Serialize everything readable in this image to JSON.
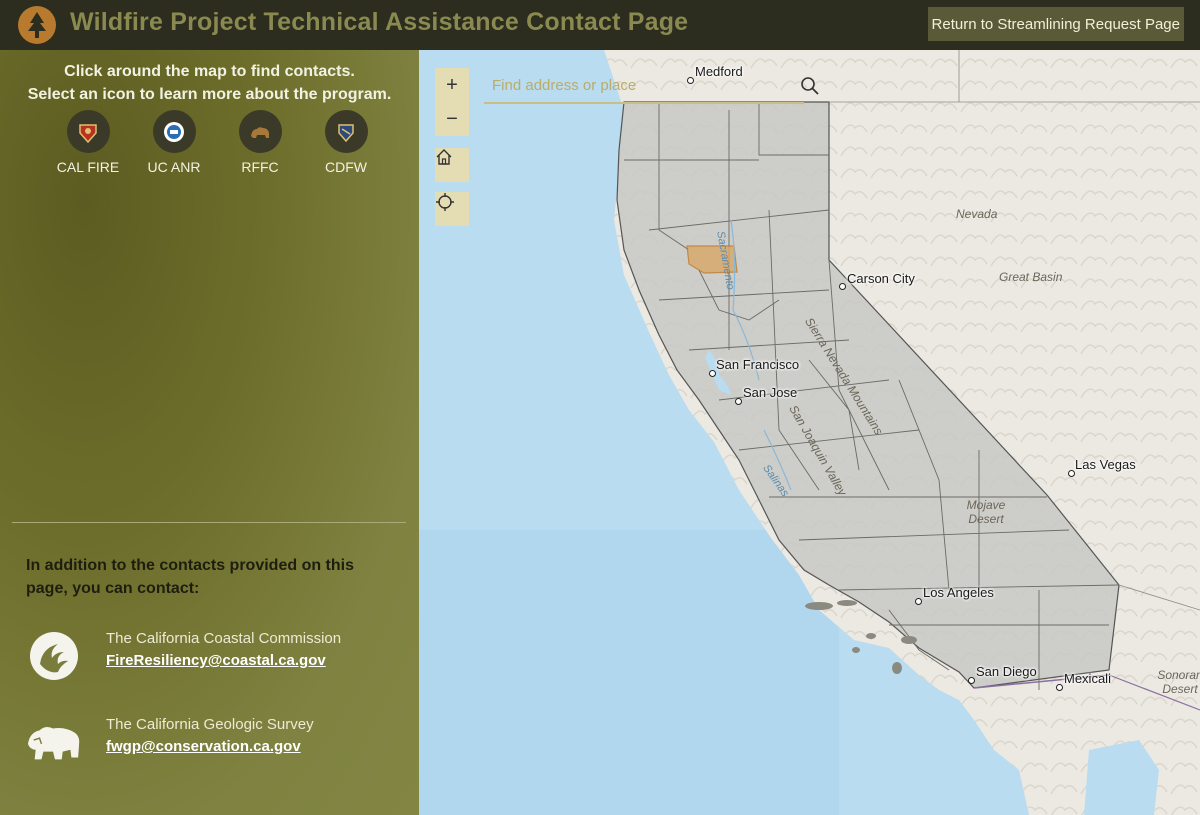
{
  "header": {
    "title": "Wildfire Project Technical Assistance Contact Page",
    "return_label": "Return to Streamlining Request Page",
    "logo_icon": "tree-logo-icon"
  },
  "sidebar": {
    "intro_line1": "Click around the map to find contacts.",
    "intro_line2": "Select an icon to learn more about the program.",
    "orgs": [
      {
        "label": "CAL FIRE",
        "icon": "cal-fire-icon"
      },
      {
        "label": "UC ANR",
        "icon": "uc-anr-icon"
      },
      {
        "label": "RFFC",
        "icon": "rffc-icon"
      },
      {
        "label": "CDFW",
        "icon": "cdfw-icon"
      }
    ],
    "also_text": "In addition to the contacts provided on this page, you can contact:",
    "contacts": [
      {
        "name": "The California Coastal Commission",
        "email": "FireResiliency@coastal.ca.gov",
        "icon": "coastal-commission-icon"
      },
      {
        "name": "The California Geologic Survey",
        "email": "fwgp@conservation.ca.gov",
        "icon": "bear-icon"
      }
    ]
  },
  "map": {
    "search_placeholder": "Find address or place",
    "zoom_in": "+",
    "zoom_out": "−",
    "cities": [
      "Medford",
      "Carson City",
      "San Francisco",
      "San Jose",
      "Las Vegas",
      "Los Angeles",
      "San Diego",
      "Mexicali"
    ],
    "regions": [
      "Nevada",
      "Great Basin",
      "Sierra Nevada Mountains",
      "San Joaquin Valley",
      "Mojave Desert",
      "Sonoran Desert"
    ],
    "rivers": [
      "Sacramento",
      "Salinas"
    ],
    "colors": {
      "ocean": "#b9dcf0",
      "land": "#ece9e2",
      "county_fill": "#c8c8c4",
      "highlight": "#d9a766",
      "panel": "#e4dcb2"
    }
  }
}
